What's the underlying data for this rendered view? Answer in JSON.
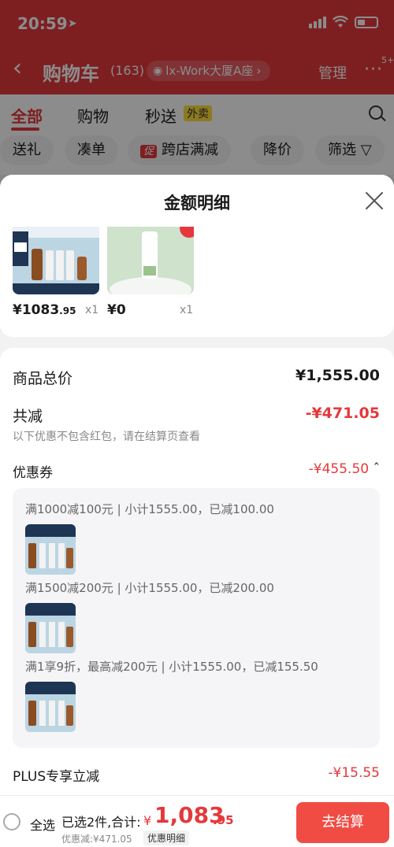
{
  "status": {
    "time": "20:59"
  },
  "nav": {
    "title": "购物车",
    "count": "(163)",
    "location": "lx-Work大厦A座",
    "manage": "管理",
    "more_badge": "5+"
  },
  "tabs": [
    {
      "label": "全部",
      "active": true
    },
    {
      "label": "购物"
    },
    {
      "label": "秒送",
      "badge": "外卖"
    }
  ],
  "chips": [
    "送礼",
    "凑单",
    "跨店满减",
    "降价",
    "筛选"
  ],
  "chip_promo_badge": "促",
  "sheet": {
    "title": "金额明细",
    "products": [
      {
        "price_int": "¥1083",
        "price_dec": ".95",
        "qty": "x1"
      },
      {
        "price_int": "¥0",
        "price_dec": "",
        "qty": "x1"
      }
    ],
    "rows": {
      "total_label": "商品总价",
      "total_value": "¥1,555.00",
      "reduce_label": "共减",
      "reduce_value": "-¥471.05",
      "reduce_note": "以下优惠不包含红包，请在结算页查看",
      "coupon_label": "优惠券",
      "coupon_value": "-¥455.50",
      "plus_label": "PLUS专享立减",
      "plus_value": "-¥15.55"
    },
    "coupons": [
      "满1000减100元 | 小计1555.00，已减100.00",
      "满1500减200元 | 小计1555.00，已减200.00",
      "满1享9折，最高减200元 | 小计1555.00，已减155.50"
    ]
  },
  "bottom": {
    "select_all": "全选",
    "selected_info": "已选2件,合计:",
    "currency": "¥",
    "total_int": "1,083",
    "total_dec": ".95",
    "discount_line": "优惠减:¥471.05",
    "discount_detail": "优惠明细",
    "checkout": "去结算"
  },
  "colors": {
    "accent": "#e4393c",
    "checkout": "#f04c44"
  }
}
